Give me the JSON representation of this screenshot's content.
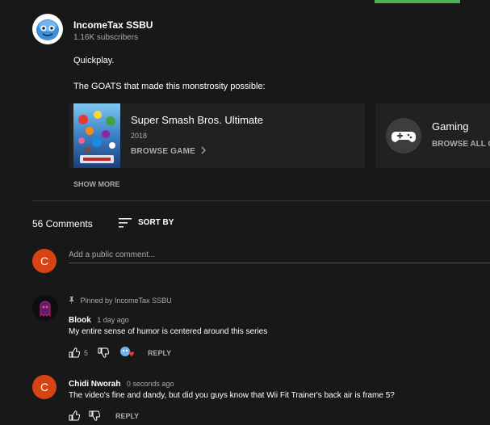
{
  "channel": {
    "name": "IncomeTax SSBU",
    "subscribers": "1.16K subscribers"
  },
  "description": {
    "line1": "Quickplay.",
    "line2": "The GOATS that made this monstrosity possible:"
  },
  "game_card": {
    "title": "Super Smash Bros. Ultimate",
    "year": "2018",
    "browse_label": "BROWSE GAME"
  },
  "category_card": {
    "title": "Gaming",
    "browse_label": "BROWSE ALL G"
  },
  "show_more": "SHOW MORE",
  "comments_header": {
    "count": "56 Comments",
    "sort_label": "SORT BY"
  },
  "comment_box": {
    "avatar_letter": "C",
    "placeholder": "Add a public comment..."
  },
  "comments": [
    {
      "pinned_label": "Pinned by IncomeTax SSBU",
      "author": "Blook",
      "time": "1 day ago",
      "text": "My entire sense of humor is centered around this series",
      "likes": "5",
      "reply_label": "REPLY"
    },
    {
      "avatar_letter": "C",
      "author": "Chidi Nworah",
      "time": "0 seconds ago",
      "text": "The video's fine and dandy, but did you guys know that Wii Fit Trainer's back air is frame 5?",
      "reply_label": "REPLY"
    }
  ],
  "colors": {
    "background": "#181818",
    "avatar_accent": "#d84315",
    "heart": "#e53935",
    "progress": "#4caf50"
  }
}
